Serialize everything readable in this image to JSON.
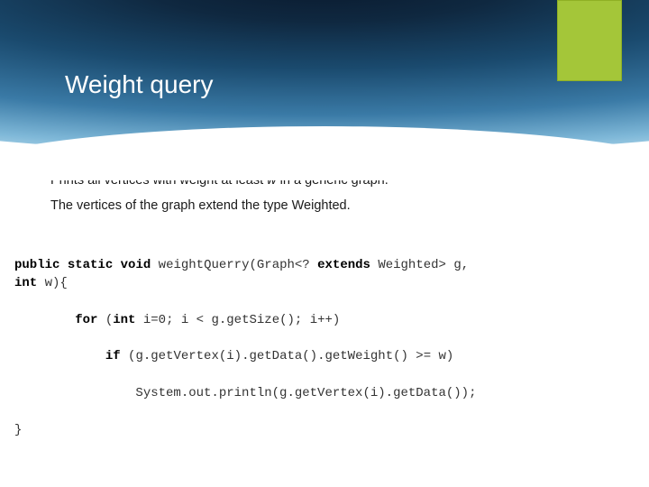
{
  "title": "Weight query",
  "desc": {
    "line1_prefix": "Prints all vertices with weight at least ",
    "line1_var": "w",
    "line1_suffix": "  in a generic graph.",
    "line2_prefix": "The vertices of the graph extend the type  ",
    "line2_type": "Weighted."
  },
  "code": {
    "l1_kw1": "public",
    "l1_kw2": "static",
    "l1_kw3": "void",
    "l1_between": " ",
    "l1_rest": " weightQuerry(Graph<? ",
    "l1_kw4": "extends",
    "l1_rest2": " Weighted> g,",
    "l2_kw": "int",
    "l2_rest": " w){",
    "l3_prefix": "        ",
    "l3_kw": "for",
    "l3_rest": " (",
    "l3_kw2": "int",
    "l3_rest2": " i=0; i < g.getSize(); i++)",
    "l4_prefix": "            ",
    "l4_kw": "if",
    "l4_rest": " (g.getVertex(i).getData().getWeight() >= w)",
    "l5": "                System.out.println(g.getVertex(i).getData());",
    "l6": "}"
  }
}
